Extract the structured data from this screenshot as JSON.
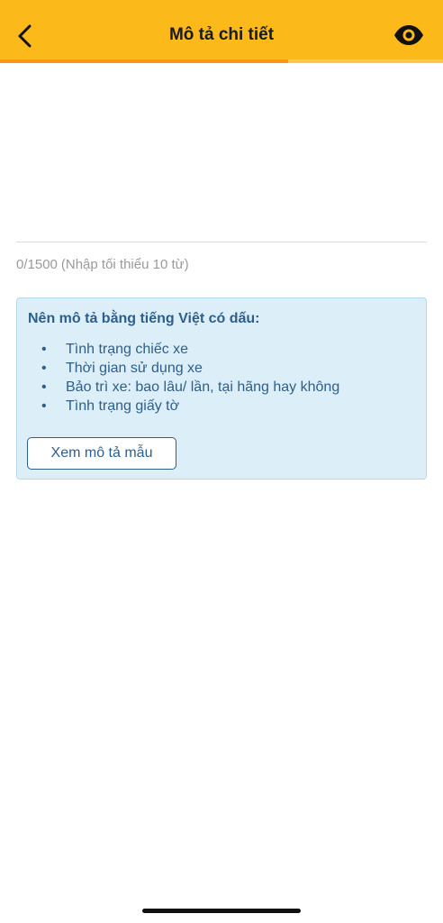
{
  "header": {
    "title": "Mô tả chi tiết",
    "back_icon": "chevron-left-icon",
    "preview_icon": "eye-icon",
    "background_color": "#FBBA1A",
    "progress_fraction": 0.65
  },
  "description": {
    "value": "",
    "char_count": "0/1500",
    "hint": "(Nhập tối thiểu 10 từ)"
  },
  "tips": {
    "heading": "Nên mô tả bằng tiếng Việt có dấu:",
    "bullet": "•",
    "items": [
      "Tình trạng chiếc xe",
      "Thời gian sử dụng xe",
      "Bảo trì xe: bao lâu/ lần, tại hãng hay không",
      "Tình trạng giấy tờ"
    ],
    "sample_button_label": "Xem mô tả mẫu",
    "accent_color": "#2D5F8C"
  }
}
